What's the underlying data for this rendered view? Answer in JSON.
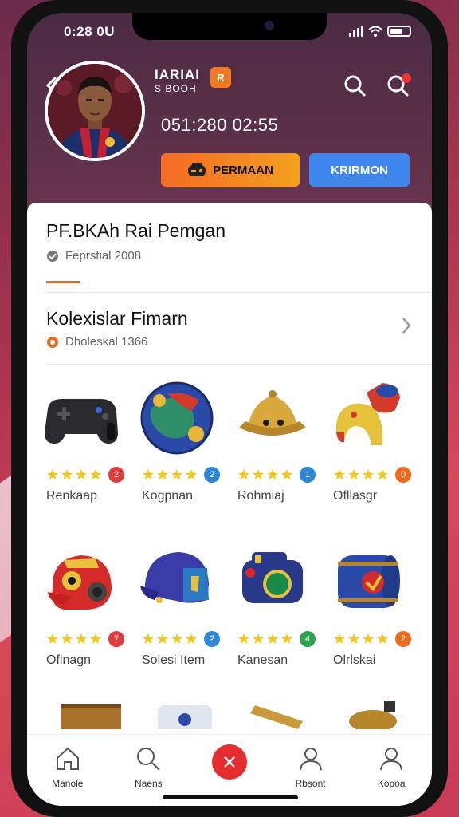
{
  "status": {
    "time": "0:28 0U"
  },
  "profile": {
    "name_line1": "IARIAI",
    "name_line2": "S.BOOH",
    "badge": "R",
    "id_text": "051:280 02:55"
  },
  "actions": {
    "play_label": "PERMAAN",
    "send_label": "KRIRMON"
  },
  "section1": {
    "title": "PF.BKAh Rai Pemgan",
    "subtitle": "Feprstial 2008"
  },
  "section2": {
    "title": "Kolexislar Fimarn",
    "subtitle": "Dholeskal 1366"
  },
  "items": [
    {
      "name": "Renkaap",
      "rating": "2",
      "rating_color": "#e13b3b",
      "icon": "gamepad-icon"
    },
    {
      "name": "Kogpnan",
      "rating": "2",
      "rating_color": "#2e86d6",
      "icon": "ball-icon"
    },
    {
      "name": "Rohmiaj",
      "rating": "1",
      "rating_color": "#2e86d6",
      "icon": "gold-hat-icon"
    },
    {
      "name": "Ofllasgr",
      "rating": "0",
      "rating_color": "#f06a1e",
      "icon": "red-helmet-icon"
    },
    {
      "name": "Oflnagn",
      "rating": "7",
      "rating_color": "#e13b3b",
      "icon": "red-mask-icon"
    },
    {
      "name": "Solesi Item",
      "rating": "2",
      "rating_color": "#2e86d6",
      "icon": "blue-helmet-icon"
    },
    {
      "name": "Kanesan",
      "rating": "4",
      "rating_color": "#2aa44a",
      "icon": "blue-device-icon"
    },
    {
      "name": "Olrlskai",
      "rating": "2",
      "rating_color": "#f06a1e",
      "icon": "barrel-icon"
    }
  ],
  "tabs": [
    {
      "label": "Manole",
      "icon": "home-icon"
    },
    {
      "label": "Naens",
      "icon": "search-icon"
    },
    {
      "label": "",
      "icon": "close-icon"
    },
    {
      "label": "Rbsont",
      "icon": "user-icon"
    },
    {
      "label": "Kopoa",
      "icon": "profile-icon"
    }
  ]
}
